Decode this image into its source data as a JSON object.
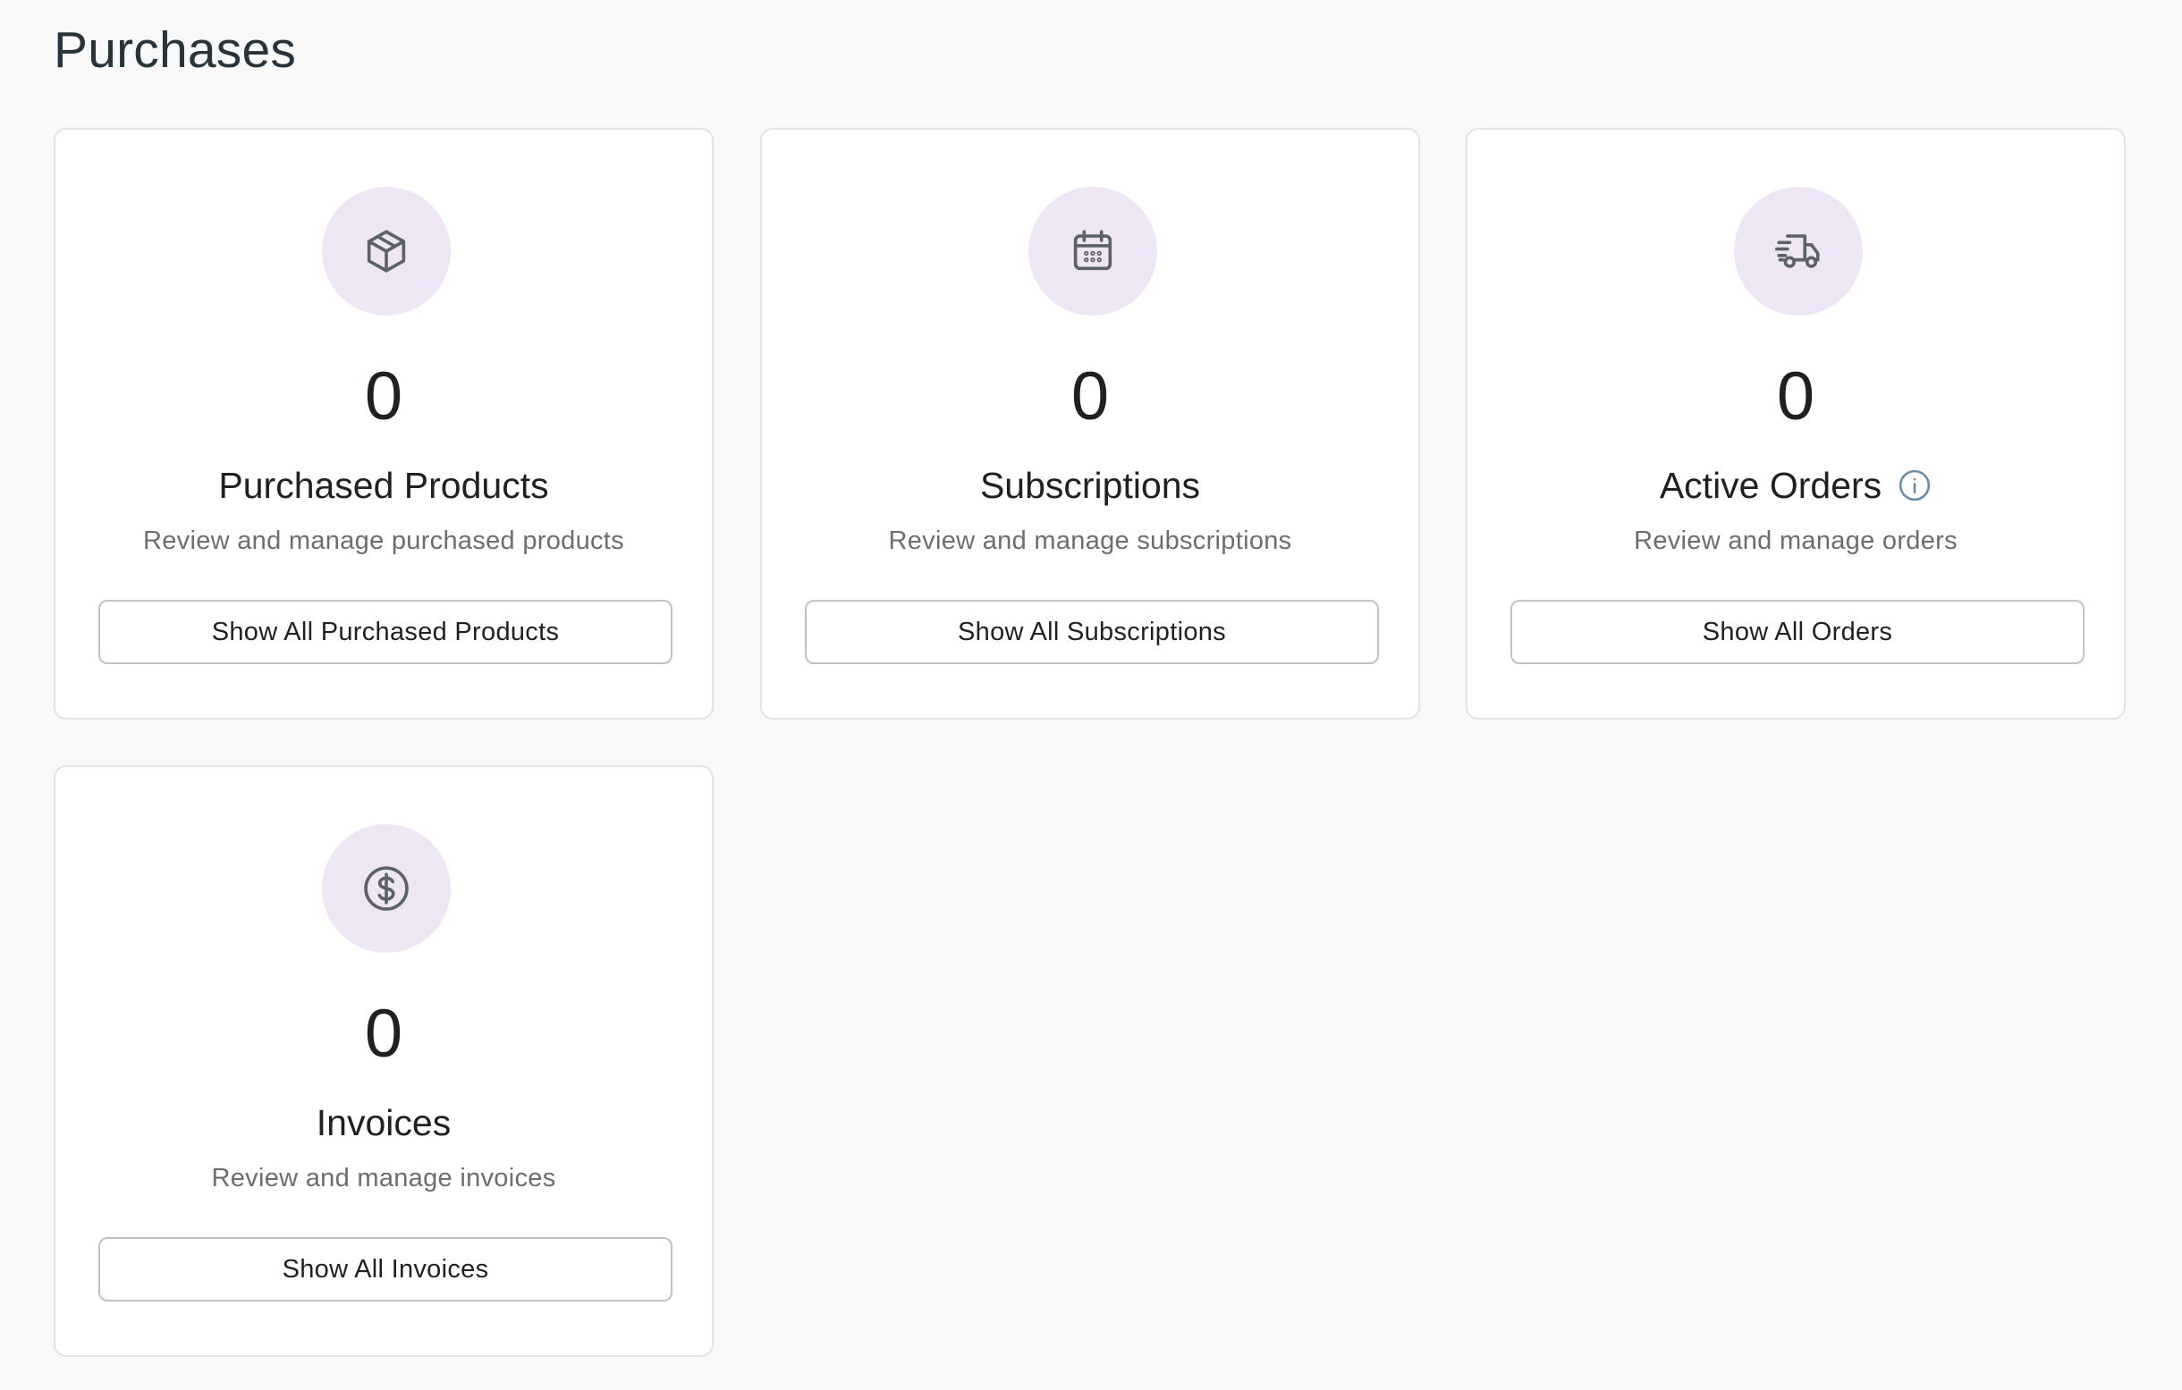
{
  "page": {
    "title": "Purchases"
  },
  "colors": {
    "background": "#f9f9f9",
    "card_background": "#ffffff",
    "icon_circle": "#eee6f4",
    "icon_stroke": "#5d6266",
    "info_icon": "#6b8aa8",
    "muted_text": "#6a6e72"
  },
  "cards": [
    {
      "icon": "package-icon",
      "count": "0",
      "title": "Purchased Products",
      "description": "Review and manage purchased products",
      "button_label": "Show All Purchased Products"
    },
    {
      "icon": "calendar-icon",
      "count": "0",
      "title": "Subscriptions",
      "description": "Review and manage subscriptions",
      "button_label": "Show All Subscriptions"
    },
    {
      "icon": "delivery-truck-icon",
      "count": "0",
      "title": "Active Orders",
      "title_icon": "info-icon",
      "description": "Review and manage orders",
      "button_label": "Show All Orders"
    },
    {
      "icon": "dollar-coin-icon",
      "count": "0",
      "title": "Invoices",
      "description": "Review and manage invoices",
      "button_label": "Show All Invoices"
    }
  ]
}
